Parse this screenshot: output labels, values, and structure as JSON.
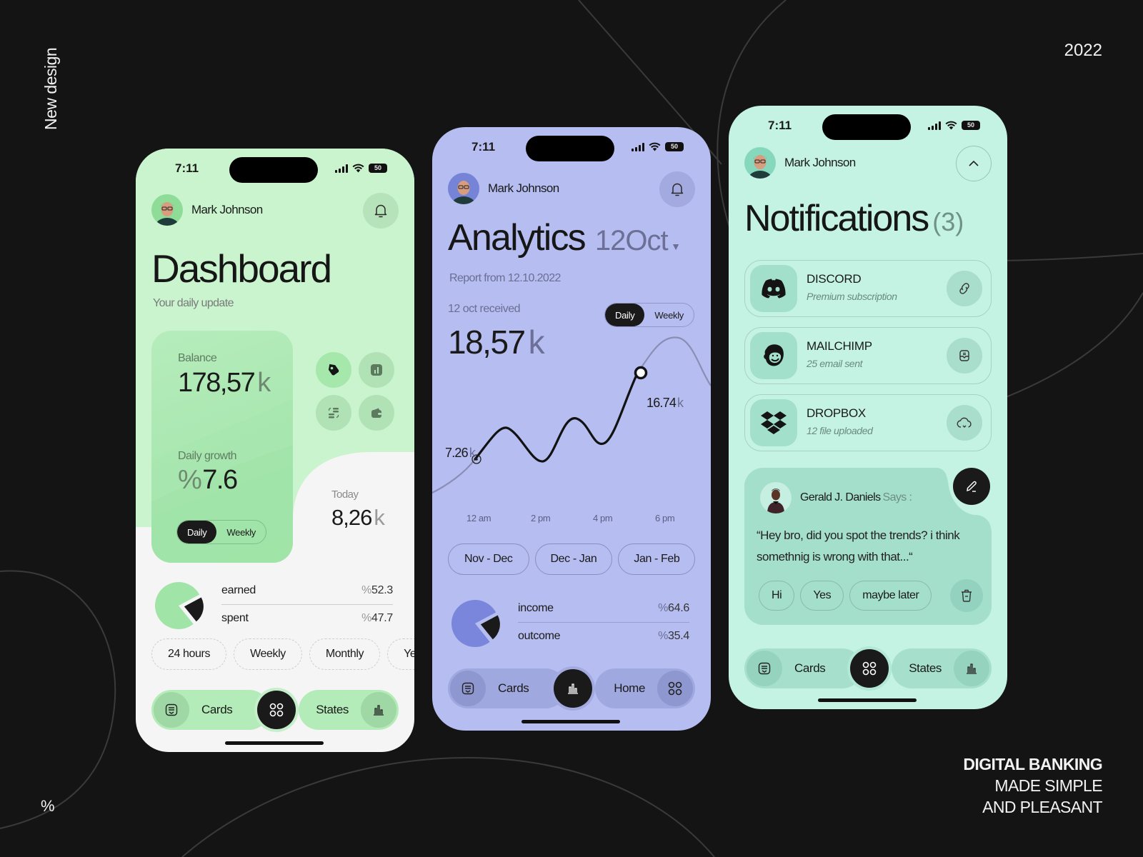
{
  "poster": {
    "side_label": "New design",
    "year": "2022",
    "corner_symbol": "%",
    "tagline": [
      "DIGITAL BANKING",
      "MADE SIMPLE",
      "AND PLEASANT"
    ]
  },
  "status_bar": {
    "time": "7:11",
    "battery": "50"
  },
  "user": {
    "name": "Mark Johnson"
  },
  "dashboard": {
    "title": "Dashboard",
    "subtitle": "Your daily update",
    "balance_label": "Balance",
    "balance_value": "178,57",
    "balance_unit": "k",
    "growth_label": "Daily growth",
    "growth_prefix": "%",
    "growth_value": "7.6",
    "toggle": [
      "Daily",
      "Weekly"
    ],
    "toggle_selected": "Daily",
    "quick_actions": [
      "tag-icon",
      "chart-box-icon",
      "exchange-icon",
      "wallet-icon"
    ],
    "today_label": "Today",
    "today_value": "8,26",
    "today_unit": "k",
    "split": [
      {
        "label": "earned",
        "prefix": "%",
        "value": "52.3",
        "percent": 52.3
      },
      {
        "label": "spent",
        "prefix": "%",
        "value": "47.7",
        "percent": 47.7
      }
    ],
    "periods": [
      "24 hours",
      "Weekly",
      "Monthly",
      "Ye"
    ],
    "tabbar": {
      "left": "Cards",
      "right": "States"
    },
    "colors": {
      "accent": "#a1e4a8",
      "dark": "#1a1a1a"
    }
  },
  "analytics": {
    "title": "Analytics",
    "date": "12Oct",
    "report": "Report from 12.10.2022",
    "received_label": "12 oct received",
    "received_value": "18,57",
    "received_unit": "k",
    "toggle": [
      "Daily",
      "Weekly"
    ],
    "toggle_selected": "Daily",
    "chart_low_label": "7.26",
    "chart_high_label": "16.74",
    "chart_unit": "k",
    "x_ticks": [
      "12 am",
      "2 pm",
      "4 pm",
      "6 pm"
    ],
    "ranges": [
      "Nov - Dec",
      "Dec - Jan",
      "Jan - Feb"
    ],
    "split": [
      {
        "label": "income",
        "prefix": "%",
        "value": "64.6",
        "percent": 64.6
      },
      {
        "label": "outcome",
        "prefix": "%",
        "value": "35.4",
        "percent": 35.4
      }
    ],
    "tabbar": {
      "left": "Cards",
      "right": "Home"
    },
    "colors": {
      "accent": "#7a86dc",
      "dark": "#1a1a1a"
    }
  },
  "notifications": {
    "title": "Notifications",
    "count": "(3)",
    "items": [
      {
        "name": "DISCORD",
        "desc": "Premium subscription",
        "icon": "discord-icon",
        "action_icon": "link-icon"
      },
      {
        "name": "MAILCHIMP",
        "desc": "25 email sent",
        "icon": "mailchimp-icon",
        "action_icon": "inbox-icon"
      },
      {
        "name": "DROPBOX",
        "desc": "12 file uploaded",
        "icon": "dropbox-icon",
        "action_icon": "cloud-icon"
      }
    ],
    "message": {
      "sender": "Gerald J. Daniels",
      "says": "Says :",
      "text": "“Hey bro, did you spot  the trends? i think somethnig is wrong with that...“",
      "replies": [
        "Hi",
        "Yes",
        "maybe later"
      ]
    },
    "tabbar": {
      "left": "Cards",
      "right": "States"
    }
  }
}
